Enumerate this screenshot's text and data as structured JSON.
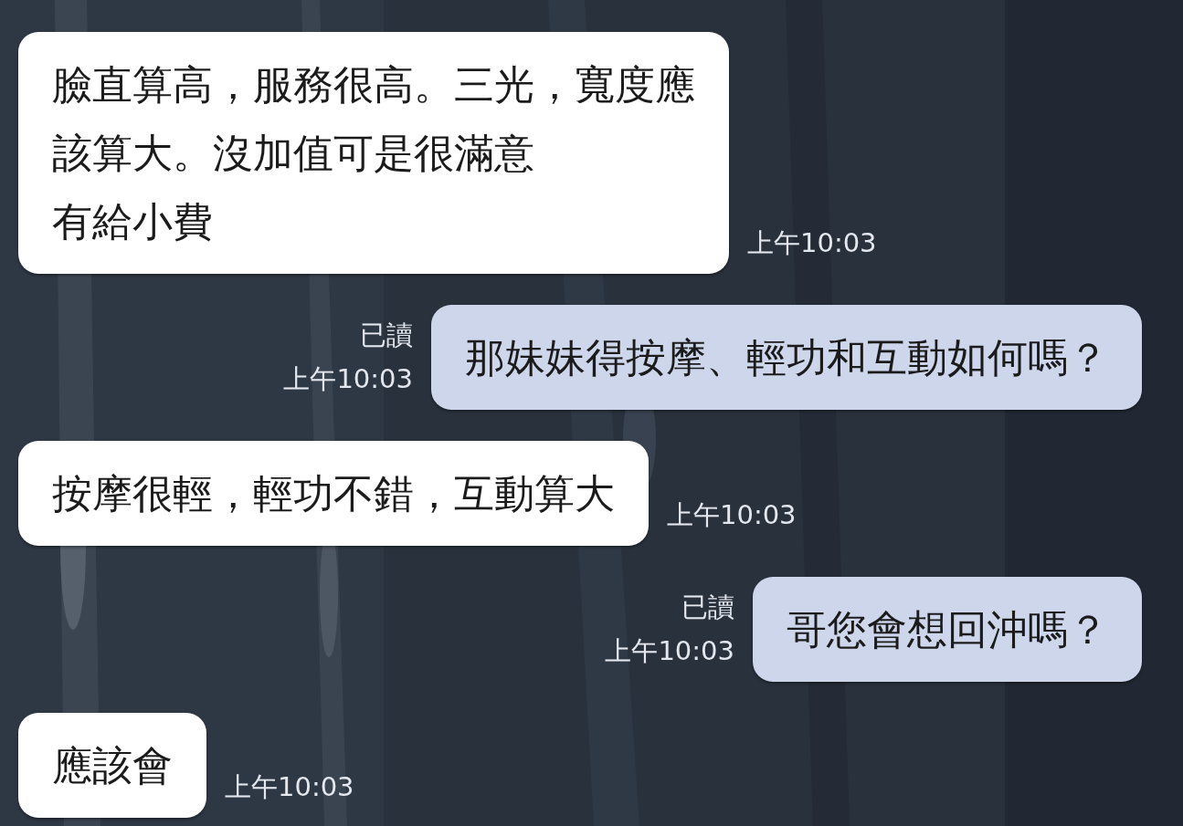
{
  "messages": [
    {
      "kind": "incoming",
      "lines": [
        "臉直算高，服務很高。三光，寬度應",
        "該算大。沒加值可是很滿意",
        "有給小費"
      ],
      "time": "上午10:03"
    },
    {
      "kind": "outgoing",
      "lines": [
        "那妹妹得按摩、輕功和互動如何嗎？"
      ],
      "read_label": "已讀",
      "time": "上午10:03"
    },
    {
      "kind": "incoming",
      "lines": [
        "按摩很輕，輕功不錯，互動算大"
      ],
      "time": "上午10:03"
    },
    {
      "kind": "outgoing",
      "lines": [
        "哥您會想回沖嗎？"
      ],
      "read_label": "已讀",
      "time": "上午10:03"
    },
    {
      "kind": "incoming",
      "lines": [
        "應該會"
      ],
      "time": "上午10:03"
    }
  ]
}
